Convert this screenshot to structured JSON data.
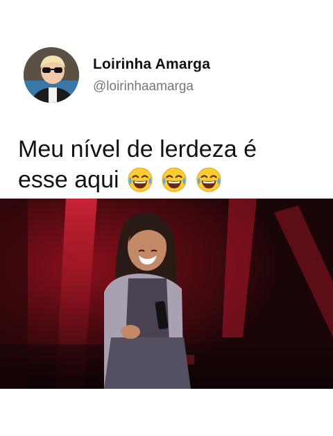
{
  "tweet": {
    "author": {
      "display_name": "Loirinha Amarga",
      "handle": "@loirinhaamarga"
    },
    "text_line1": "Meu nível de lerdeza é",
    "text_line2": "esse aqui",
    "emojis": [
      "face-with-tears-of-joy",
      "face-with-tears-of-joy",
      "face-with-tears-of-joy"
    ]
  },
  "media": {
    "type": "video",
    "scene": "stage"
  },
  "colors": {
    "text": "#111111",
    "handle": "#6f7780",
    "stage_red": "#c4142a",
    "background": "#ffffff"
  }
}
